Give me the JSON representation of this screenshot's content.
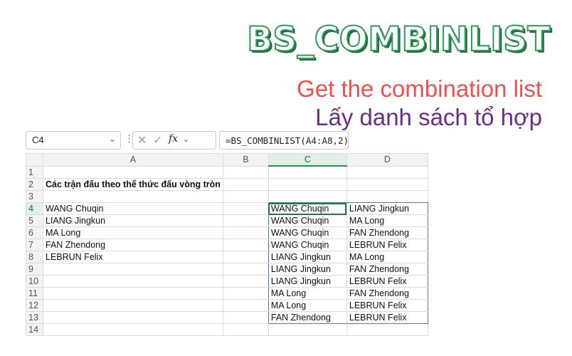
{
  "banner": {
    "title": "BS_COMBINLIST",
    "subtitle_en": "Get the combination list",
    "subtitle_vi": "Lấy danh sách tổ hợp"
  },
  "formula_bar": {
    "name_box": "C4",
    "fx_label": "fx",
    "formula": "=BS_COMBINLIST(A4:A8,2)"
  },
  "sheet": {
    "columns": [
      "A",
      "B",
      "C",
      "D"
    ],
    "rows": [
      {
        "n": "1",
        "A": "",
        "B": "",
        "C": "",
        "D": ""
      },
      {
        "n": "2",
        "A": "Các trận đấu theo thể thức đấu vòng tròn",
        "B": "",
        "C": "",
        "D": ""
      },
      {
        "n": "3",
        "A": "",
        "B": "",
        "C": "",
        "D": ""
      },
      {
        "n": "4",
        "A": "WANG Chuqin",
        "B": "",
        "C": "WANG Chuqin",
        "D": "LIANG Jingkun"
      },
      {
        "n": "5",
        "A": "LIANG Jingkun",
        "B": "",
        "C": "WANG Chuqin",
        "D": "MA Long"
      },
      {
        "n": "6",
        "A": "MA Long",
        "B": "",
        "C": "WANG Chuqin",
        "D": "FAN Zhendong"
      },
      {
        "n": "7",
        "A": "FAN Zhendong",
        "B": "",
        "C": "WANG Chuqin",
        "D": "LEBRUN Felix"
      },
      {
        "n": "8",
        "A": "LEBRUN Felix",
        "B": "",
        "C": "LIANG Jingkun",
        "D": "MA Long"
      },
      {
        "n": "9",
        "A": "",
        "B": "",
        "C": "LIANG Jingkun",
        "D": "FAN Zhendong"
      },
      {
        "n": "10",
        "A": "",
        "B": "",
        "C": "LIANG Jingkun",
        "D": "LEBRUN Felix"
      },
      {
        "n": "11",
        "A": "",
        "B": "",
        "C": "MA Long",
        "D": "FAN Zhendong"
      },
      {
        "n": "12",
        "A": "",
        "B": "",
        "C": "MA Long",
        "D": "LEBRUN Felix"
      },
      {
        "n": "13",
        "A": "",
        "B": "",
        "C": "FAN Zhendong",
        "D": "LEBRUN Felix"
      },
      {
        "n": "14",
        "A": "",
        "B": "",
        "C": "",
        "D": ""
      }
    ]
  },
  "colors": {
    "title_green": "#2e9a57",
    "subtitle_red": "#ee4f4f",
    "subtitle_purple": "#6b2d86",
    "active_green": "#1f7a44",
    "spill_blue": "#4a7ec9"
  }
}
